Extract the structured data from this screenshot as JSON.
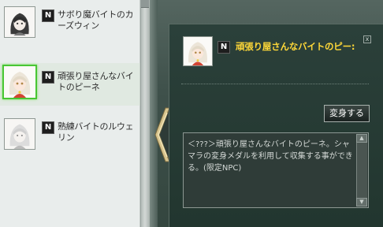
{
  "npc_list": {
    "items": [
      {
        "badge": "N",
        "name": "サボり魔バイトのカーズウィン",
        "selected": false
      },
      {
        "badge": "N",
        "name": "頑張り屋さんなバイトのピーネ",
        "selected": true
      },
      {
        "badge": "N",
        "name": "熟練バイトのルウェリン",
        "selected": false
      }
    ]
  },
  "detail": {
    "badge": "N",
    "title": "頑張り屋さんなバイトのピー:",
    "close_label": "x",
    "transform_button": "変身する",
    "description": "＜???＞頑張り屋さんなバイトのピーネ。シャマラの変身メダルを利用して収集する事ができる。(限定NPC)"
  },
  "colors": {
    "title": "#ffd838",
    "selected_border": "#49c634",
    "panel_bg": "#22362f"
  },
  "icons": {
    "close": "close-icon",
    "tab": "tab-arrow-icon",
    "scroll_up": "scroll-up-icon",
    "scroll_down": "scroll-down-icon"
  }
}
